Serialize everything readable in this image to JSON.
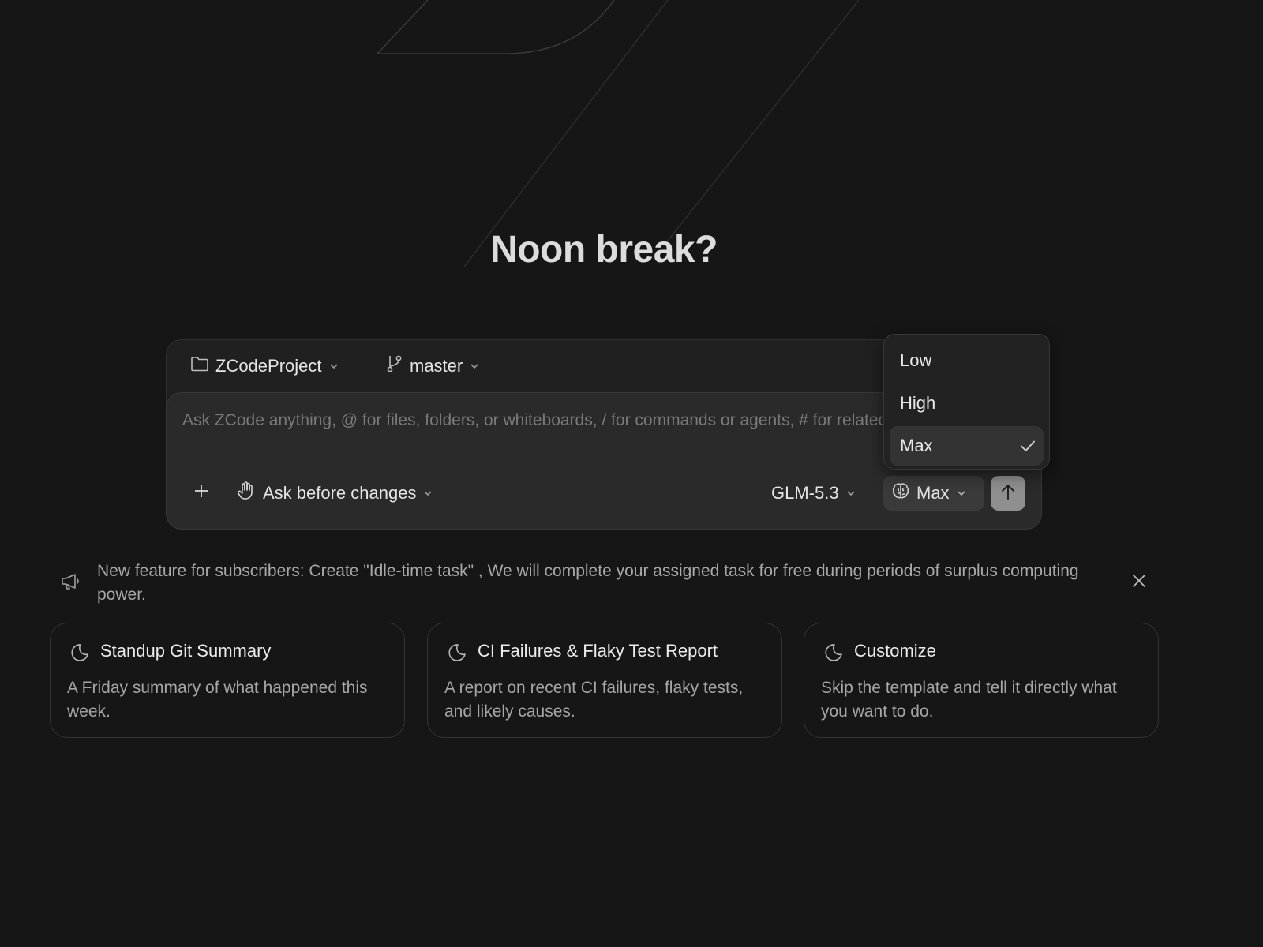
{
  "greeting": "Noon break?",
  "composer": {
    "project": {
      "label": "ZCodeProject",
      "icon": "folder-icon"
    },
    "branch": {
      "label": "master",
      "icon": "git-branch-icon"
    },
    "input": {
      "value": "",
      "placeholder": "Ask ZCode anything, @ for files, folders, or whiteboards, / for commands or agents, # for related conversations"
    },
    "toolbar": {
      "attach_icon": "plus-icon",
      "mode_label": "Ask before changes",
      "mode_icon": "hand-icon",
      "model_label": "GLM-5.3",
      "effort_label": "Max",
      "effort_icon": "brain-icon",
      "send_icon": "arrow-up-icon"
    }
  },
  "effort_menu": {
    "options": [
      {
        "label": "Low",
        "selected": false
      },
      {
        "label": "High",
        "selected": false
      },
      {
        "label": "Max",
        "selected": true
      }
    ]
  },
  "notice": {
    "icon": "megaphone-icon",
    "text": "New feature for subscribers: Create \"Idle-time task\" , We will complete your assigned task for free during periods of surplus computing power.",
    "close_icon": "close-icon"
  },
  "cards": [
    {
      "icon": "moon-icon",
      "title": "Standup Git Summary",
      "description": "A Friday summary of what happened this week."
    },
    {
      "icon": "moon-icon",
      "title": "CI Failures & Flaky Test Report",
      "description": "A report on recent CI failures, flaky tests, and likely causes."
    },
    {
      "icon": "moon-icon",
      "title": "Customize",
      "description": "Skip the template and tell it directly what you want to do."
    }
  ],
  "colors": {
    "background": "#161616",
    "surface": "#202020",
    "input_surface": "#2a2a2a",
    "send_button": "#8f8f8f",
    "text_primary": "#e8e8e8",
    "text_muted": "#a8a8a8"
  }
}
